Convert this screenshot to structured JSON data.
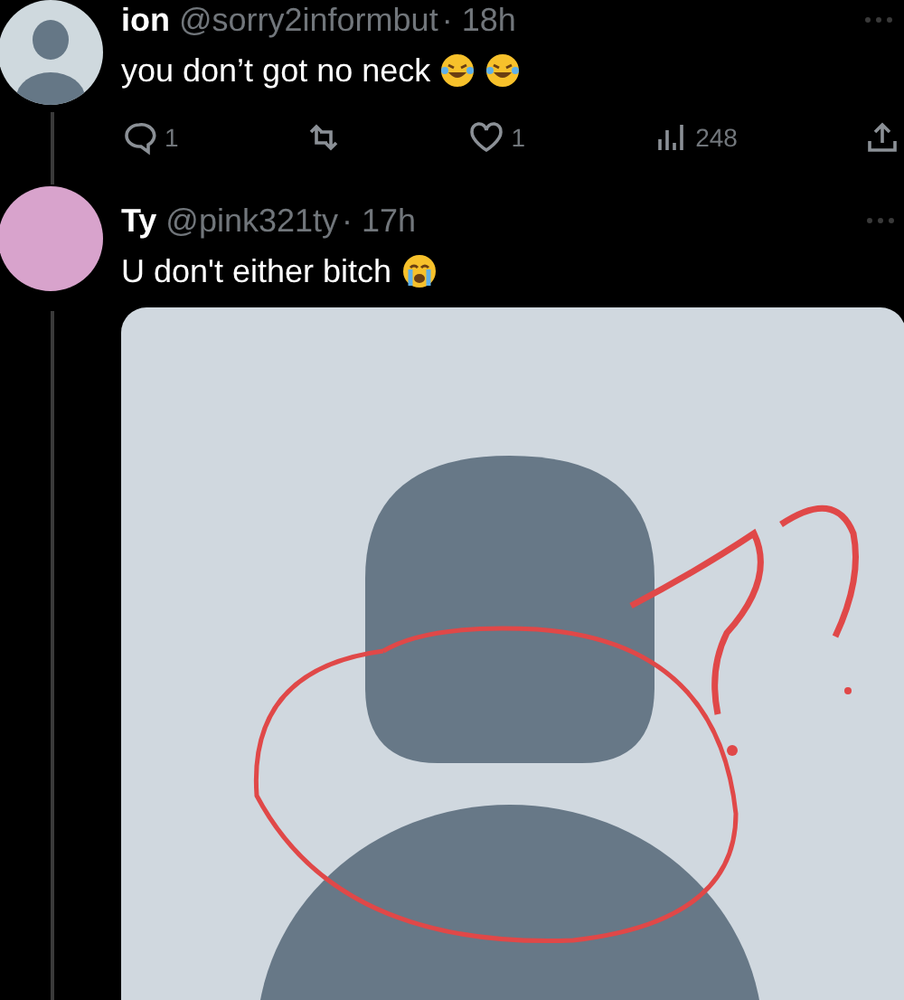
{
  "tweets": [
    {
      "avatar": {
        "kind": "default"
      },
      "name": "ion",
      "handle": "@sorry2informbut",
      "time": "· 18h",
      "text": "you don’t got no neck",
      "emoji_icons": [
        {
          "kind": "laughing"
        },
        {
          "kind": "laughing"
        }
      ],
      "actions": [
        {
          "kind": "reply",
          "count": "1"
        },
        {
          "kind": "repost"
        },
        {
          "kind": "like",
          "count": "1"
        },
        {
          "kind": "views",
          "count": "248"
        },
        {
          "kind": "share"
        }
      ]
    },
    {
      "avatar": {
        "kind": "plain",
        "color": "#d8a3cc"
      },
      "name": "Ty",
      "handle": "@pink321ty",
      "time": "· 17h",
      "text": "U don't either bitch",
      "emoji_icons": [
        {
          "kind": "crying"
        }
      ],
      "media": {
        "kind": "picture"
      }
    }
  ]
}
